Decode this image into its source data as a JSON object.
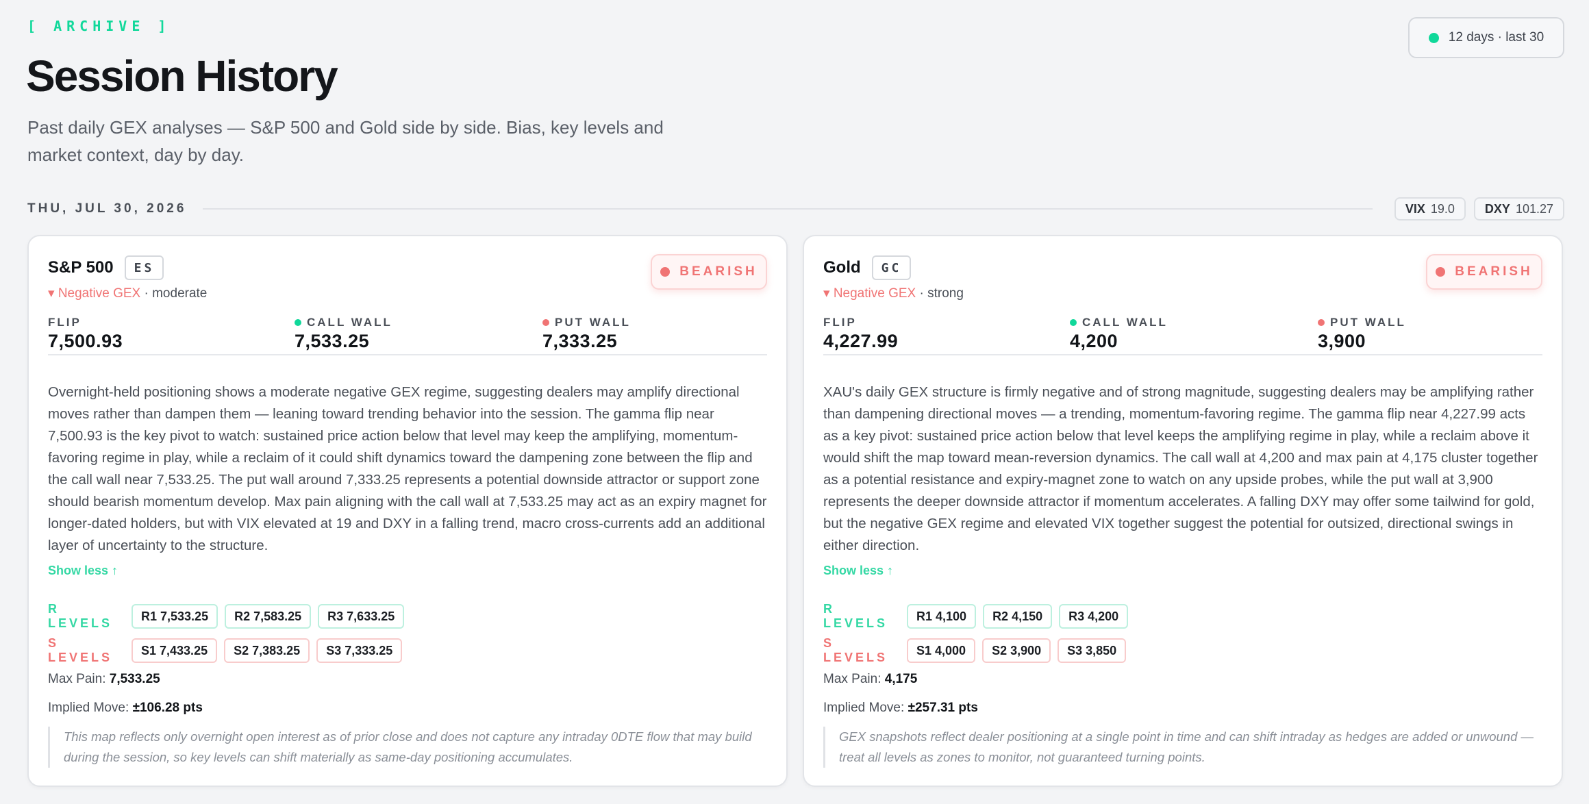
{
  "header": {
    "tag": "[ ARCHIVE ]",
    "title": "Session History",
    "subtitle": "Past daily GEX analyses — S&P 500 and Gold side by side. Bias, key levels and market context, day by day.",
    "range_label": "12 days · last 30"
  },
  "session": {
    "date": "THU, JUL 30, 2026",
    "vix_label": "VIX",
    "vix_value": "19.0",
    "dxy_label": "DXY",
    "dxy_value": "101.27"
  },
  "colors": {
    "accent_green": "#10d89a",
    "bearish_red": "#f07474"
  },
  "cards": [
    {
      "name": "S&P 500",
      "ticker": "ES",
      "gex_regime": "▾ Negative GEX",
      "gex_strength": " · moderate",
      "bias": "BEARISH",
      "flip_label": "FLIP",
      "flip_value": "7,500.93",
      "call_wall_label": "CALL WALL",
      "call_wall_value": "7,533.25",
      "put_wall_label": "PUT WALL",
      "put_wall_value": "7,333.25",
      "narrative": "Overnight-held positioning shows a moderate negative GEX regime, suggesting dealers may amplify directional moves rather than dampen them — leaning toward trending behavior into the session. The gamma flip near 7,500.93 is the key pivot to watch: sustained price action below that level may keep the amplifying, momentum-favoring regime in play, while a reclaim of it could shift dynamics toward the dampening zone between the flip and the call wall near 7,533.25. The put wall around 7,333.25 represents a potential downside attractor or support zone should bearish momentum develop. Max pain aligning with the call wall at 7,533.25 may act as an expiry magnet for longer-dated holders, but with VIX elevated at 19 and DXY in a falling trend, macro cross-currents add an additional layer of uncertainty to the structure.",
      "toggle": "Show less ↑",
      "r_label": "R LEVELS",
      "r_levels": [
        "R1 7,533.25",
        "R2 7,583.25",
        "R3 7,633.25"
      ],
      "s_label": "S LEVELS",
      "s_levels": [
        "S1 7,433.25",
        "S2 7,383.25",
        "S3 7,333.25"
      ],
      "max_pain_label": "Max Pain:",
      "max_pain": "7,533.25",
      "implied_move_label": "Implied Move:",
      "implied_move": "±106.28 pts",
      "note": "This map reflects only overnight open interest as of prior close and does not capture any intraday 0DTE flow that may build during the session, so key levels can shift materially as same-day positioning accumulates."
    },
    {
      "name": "Gold",
      "ticker": "GC",
      "gex_regime": "▾ Negative GEX",
      "gex_strength": " · strong",
      "bias": "BEARISH",
      "flip_label": "FLIP",
      "flip_value": "4,227.99",
      "call_wall_label": "CALL WALL",
      "call_wall_value": "4,200",
      "put_wall_label": "PUT WALL",
      "put_wall_value": "3,900",
      "narrative": "XAU's daily GEX structure is firmly negative and of strong magnitude, suggesting dealers may be amplifying rather than dampening directional moves — a trending, momentum-favoring regime. The gamma flip near 4,227.99 acts as a key pivot: sustained price action below that level keeps the amplifying regime in play, while a reclaim above it would shift the map toward mean-reversion dynamics. The call wall at 4,200 and max pain at 4,175 cluster together as a potential resistance and expiry-magnet zone to watch on any upside probes, while the put wall at 3,900 represents the deeper downside attractor if momentum accelerates. A falling DXY may offer some tailwind for gold, but the negative GEX regime and elevated VIX together suggest the potential for outsized, directional swings in either direction.",
      "toggle": "Show less ↑",
      "r_label": "R LEVELS",
      "r_levels": [
        "R1 4,100",
        "R2 4,150",
        "R3 4,200"
      ],
      "s_label": "S LEVELS",
      "s_levels": [
        "S1 4,000",
        "S2 3,900",
        "S3 3,850"
      ],
      "max_pain_label": "Max Pain:",
      "max_pain": "4,175",
      "implied_move_label": "Implied Move:",
      "implied_move": "±257.31 pts",
      "note": "GEX snapshots reflect dealer positioning at a single point in time and can shift intraday as hedges are added or unwound — treat all levels as zones to monitor, not guaranteed turning points."
    }
  ]
}
